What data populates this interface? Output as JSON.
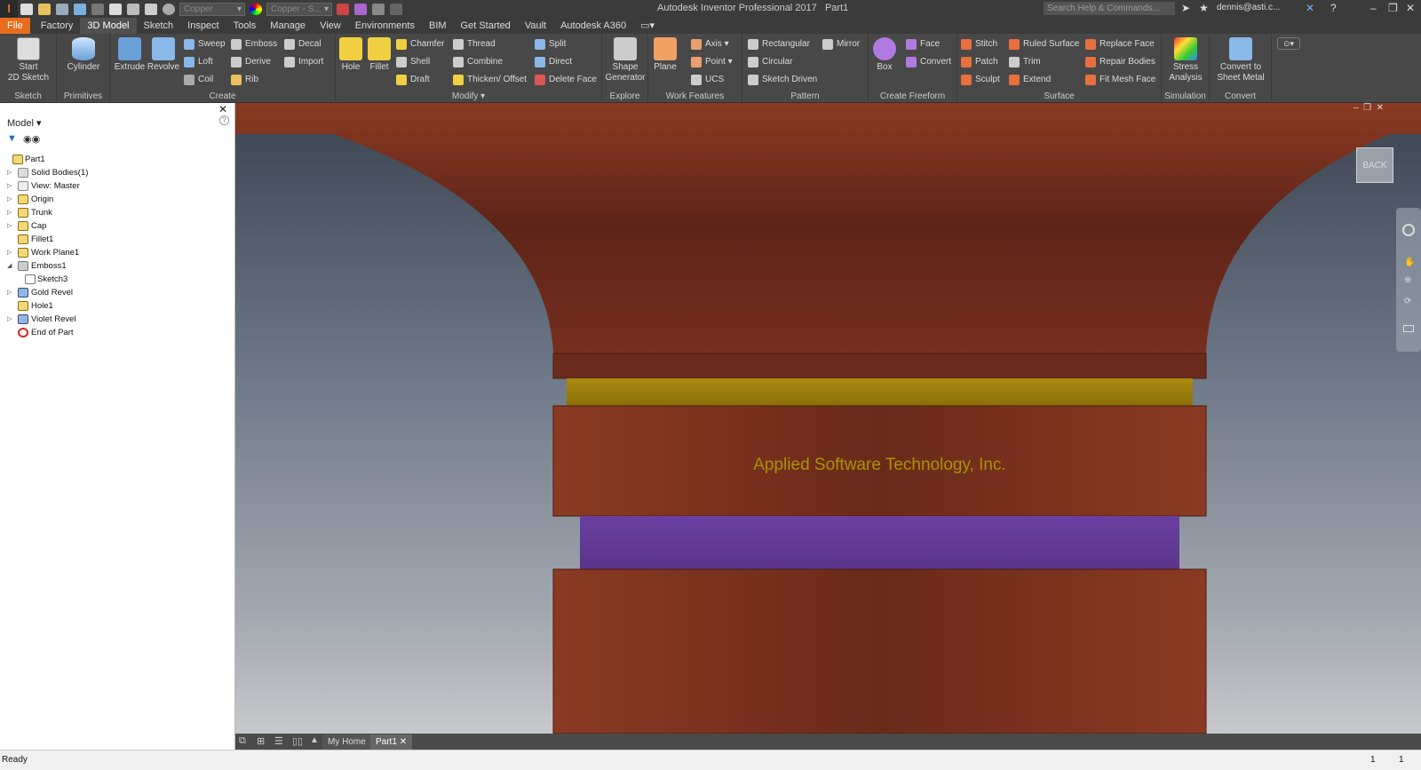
{
  "app": {
    "title": "Autodesk Inventor Professional 2017",
    "document": "Part1",
    "logo_letter": "I"
  },
  "qat": {
    "material": "Copper",
    "appearance": "Copper - S...",
    "search_placeholder": "Search Help & Commands...",
    "user": "dennis@asti.c..."
  },
  "menu_tabs": [
    "File",
    "Factory",
    "3D Model",
    "Sketch",
    "Inspect",
    "Tools",
    "Manage",
    "View",
    "Environments",
    "BIM",
    "Get Started",
    "Vault",
    "Autodesk A360"
  ],
  "ribbon": {
    "sketch": {
      "title": "Sketch",
      "start": "Start",
      "start2": "2D Sketch"
    },
    "primitives": {
      "title": "Primitives",
      "cylinder": "Cylinder"
    },
    "create": {
      "title": "Create",
      "extrude": "Extrude",
      "revolve": "Revolve",
      "sweep": "Sweep",
      "loft": "Loft",
      "coil": "Coil",
      "emboss": "Emboss",
      "derive": "Derive",
      "rib": "Rib",
      "decal": "Decal",
      "import": "Import"
    },
    "modify": {
      "title": "Modify",
      "hole": "Hole",
      "fillet": "Fillet",
      "chamfer": "Chamfer",
      "shell": "Shell",
      "draft": "Draft",
      "thread": "Thread",
      "combine": "Combine",
      "thicken": "Thicken/ Offset",
      "split": "Split",
      "direct": "Direct",
      "delete_face": "Delete Face"
    },
    "explore": {
      "title": "Explore",
      "shape1": "Shape",
      "shape2": "Generator"
    },
    "work": {
      "title": "Work Features",
      "plane": "Plane",
      "axis": "Axis",
      "point": "Point",
      "ucs": "UCS"
    },
    "pattern": {
      "title": "Pattern",
      "rectangular": "Rectangular",
      "circular": "Circular",
      "sketch_driven": "Sketch Driven",
      "mirror": "Mirror"
    },
    "freeform": {
      "title": "Create Freeform",
      "box": "Box",
      "face": "Face",
      "convert": "Convert"
    },
    "surface": {
      "title": "Surface",
      "stitch": "Stitch",
      "patch": "Patch",
      "sculpt": "Sculpt",
      "ruled": "Ruled Surface",
      "trim": "Trim",
      "extend": "Extend",
      "replace": "Replace Face",
      "repair": "Repair Bodies",
      "fitmesh": "Fit Mesh Face"
    },
    "simulation": {
      "title": "Simulation",
      "stress1": "Stress",
      "stress2": "Analysis"
    },
    "convert": {
      "title": "Convert",
      "c1": "Convert to",
      "c2": "Sheet Metal"
    }
  },
  "browser": {
    "header": "Model",
    "items": [
      "Part1",
      "Solid Bodies(1)",
      "View: Master",
      "Origin",
      "Trunk",
      "Cap",
      "Fillet1",
      "Work Plane1",
      "Emboss1",
      "Sketch3",
      "Gold Revel",
      "Hole1",
      "Violet Revel",
      "End of Part"
    ]
  },
  "viewport": {
    "emboss_text": "Applied Software Technology, Inc.",
    "viewcube": "BACK"
  },
  "doc_tabs": {
    "home": "My Home",
    "part": "Part1"
  },
  "status": {
    "text": "Ready",
    "n1": "1",
    "n2": "1"
  },
  "colors": {
    "copper": "#7a3220",
    "gold": "#b89a10",
    "violet": "#6a40a0",
    "accent": "#e86d1f"
  }
}
